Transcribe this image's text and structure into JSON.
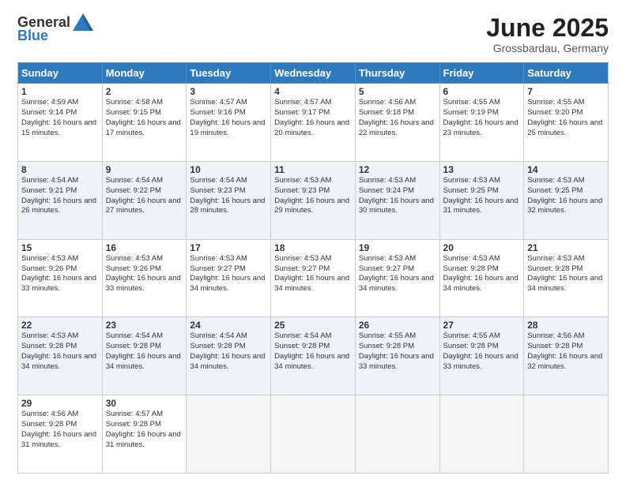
{
  "header": {
    "logo_line1": "General",
    "logo_line2": "Blue",
    "month_title": "June 2025",
    "location": "Grossbardau, Germany"
  },
  "days_of_week": [
    "Sunday",
    "Monday",
    "Tuesday",
    "Wednesday",
    "Thursday",
    "Friday",
    "Saturday"
  ],
  "weeks": [
    [
      {
        "day": 1,
        "sunrise": "4:59 AM",
        "sunset": "9:14 PM",
        "daylight": "16 hours and 15 minutes."
      },
      {
        "day": 2,
        "sunrise": "4:58 AM",
        "sunset": "9:15 PM",
        "daylight": "16 hours and 17 minutes."
      },
      {
        "day": 3,
        "sunrise": "4:57 AM",
        "sunset": "9:16 PM",
        "daylight": "16 hours and 19 minutes."
      },
      {
        "day": 4,
        "sunrise": "4:57 AM",
        "sunset": "9:17 PM",
        "daylight": "16 hours and 20 minutes."
      },
      {
        "day": 5,
        "sunrise": "4:56 AM",
        "sunset": "9:18 PM",
        "daylight": "16 hours and 22 minutes."
      },
      {
        "day": 6,
        "sunrise": "4:55 AM",
        "sunset": "9:19 PM",
        "daylight": "16 hours and 23 minutes."
      },
      {
        "day": 7,
        "sunrise": "4:55 AM",
        "sunset": "9:20 PM",
        "daylight": "16 hours and 25 minutes."
      }
    ],
    [
      {
        "day": 8,
        "sunrise": "4:54 AM",
        "sunset": "9:21 PM",
        "daylight": "16 hours and 26 minutes."
      },
      {
        "day": 9,
        "sunrise": "4:54 AM",
        "sunset": "9:22 PM",
        "daylight": "16 hours and 27 minutes."
      },
      {
        "day": 10,
        "sunrise": "4:54 AM",
        "sunset": "9:23 PM",
        "daylight": "16 hours and 28 minutes."
      },
      {
        "day": 11,
        "sunrise": "4:53 AM",
        "sunset": "9:23 PM",
        "daylight": "16 hours and 29 minutes."
      },
      {
        "day": 12,
        "sunrise": "4:53 AM",
        "sunset": "9:24 PM",
        "daylight": "16 hours and 30 minutes."
      },
      {
        "day": 13,
        "sunrise": "4:53 AM",
        "sunset": "9:25 PM",
        "daylight": "16 hours and 31 minutes."
      },
      {
        "day": 14,
        "sunrise": "4:53 AM",
        "sunset": "9:25 PM",
        "daylight": "16 hours and 32 minutes."
      }
    ],
    [
      {
        "day": 15,
        "sunrise": "4:53 AM",
        "sunset": "9:26 PM",
        "daylight": "16 hours and 33 minutes."
      },
      {
        "day": 16,
        "sunrise": "4:53 AM",
        "sunset": "9:26 PM",
        "daylight": "16 hours and 33 minutes."
      },
      {
        "day": 17,
        "sunrise": "4:53 AM",
        "sunset": "9:27 PM",
        "daylight": "16 hours and 34 minutes."
      },
      {
        "day": 18,
        "sunrise": "4:53 AM",
        "sunset": "9:27 PM",
        "daylight": "16 hours and 34 minutes."
      },
      {
        "day": 19,
        "sunrise": "4:53 AM",
        "sunset": "9:27 PM",
        "daylight": "16 hours and 34 minutes."
      },
      {
        "day": 20,
        "sunrise": "4:53 AM",
        "sunset": "9:28 PM",
        "daylight": "16 hours and 34 minutes."
      },
      {
        "day": 21,
        "sunrise": "4:53 AM",
        "sunset": "9:28 PM",
        "daylight": "16 hours and 34 minutes."
      }
    ],
    [
      {
        "day": 22,
        "sunrise": "4:53 AM",
        "sunset": "9:28 PM",
        "daylight": "16 hours and 34 minutes."
      },
      {
        "day": 23,
        "sunrise": "4:54 AM",
        "sunset": "9:28 PM",
        "daylight": "16 hours and 34 minutes."
      },
      {
        "day": 24,
        "sunrise": "4:54 AM",
        "sunset": "9:28 PM",
        "daylight": "16 hours and 34 minutes."
      },
      {
        "day": 25,
        "sunrise": "4:54 AM",
        "sunset": "9:28 PM",
        "daylight": "16 hours and 34 minutes."
      },
      {
        "day": 26,
        "sunrise": "4:55 AM",
        "sunset": "9:28 PM",
        "daylight": "16 hours and 33 minutes."
      },
      {
        "day": 27,
        "sunrise": "4:55 AM",
        "sunset": "9:28 PM",
        "daylight": "16 hours and 33 minutes."
      },
      {
        "day": 28,
        "sunrise": "4:56 AM",
        "sunset": "9:28 PM",
        "daylight": "16 hours and 32 minutes."
      }
    ],
    [
      {
        "day": 29,
        "sunrise": "4:56 AM",
        "sunset": "9:28 PM",
        "daylight": "16 hours and 31 minutes."
      },
      {
        "day": 30,
        "sunrise": "4:57 AM",
        "sunset": "9:28 PM",
        "daylight": "16 hours and 31 minutes."
      },
      null,
      null,
      null,
      null,
      null
    ]
  ]
}
